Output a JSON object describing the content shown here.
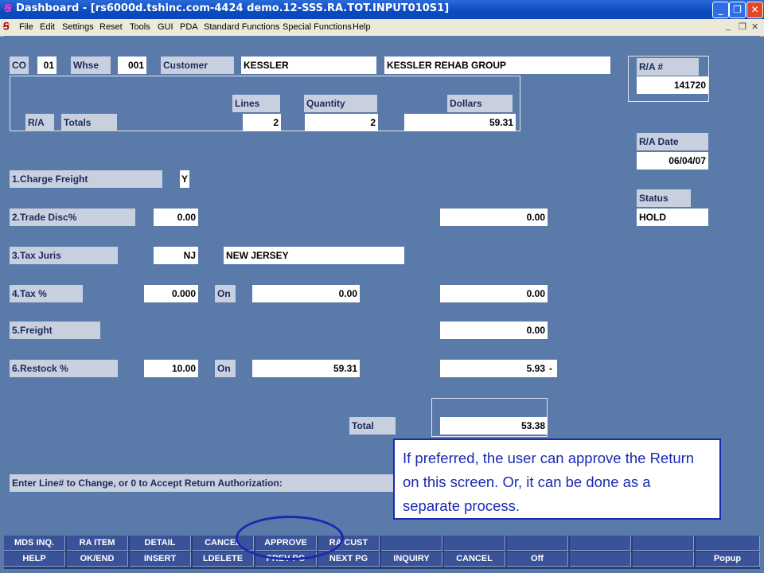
{
  "window": {
    "title": "Dashboard - [rs6000d.tshinc.com-4424 demo.12-SSS.RA.TOT.INPUT010S1]",
    "app_icon": "sss-logo-icon",
    "buttons": {
      "minimize": "_",
      "maximize": "❐",
      "close": "✕"
    }
  },
  "menu": {
    "items": [
      "File",
      "Edit",
      "Settings",
      "Reset",
      "Tools",
      "GUI",
      "PDA",
      "Standard Functions",
      "Special Functions",
      "Help"
    ],
    "mdi_controls": [
      "_",
      "❐",
      "✕"
    ]
  },
  "header": {
    "co_label": "CO",
    "co_value": "01",
    "whse_label": "Whse",
    "whse_value": "001",
    "customer_label": "Customer",
    "customer_value": "KESSLER",
    "customer_name": "KESSLER REHAB GROUP",
    "ra_label": "R/A #",
    "ra_value": "141720"
  },
  "totals_grid": {
    "ra_label": "R/A",
    "totals_label": "Totals",
    "lines_label": "Lines",
    "lines_value": "2",
    "quantity_label": "Quantity",
    "quantity_value": "2",
    "dollars_label": "Dollars",
    "dollars_value": "59.31"
  },
  "side": {
    "ra_date_label": "R/A Date",
    "ra_date_value": "06/04/07",
    "status_label": "Status",
    "status_value": "HOLD"
  },
  "lines": {
    "charge_freight_label": "1.Charge Freight",
    "charge_freight_value": "Y",
    "trade_disc_label": "2.Trade Disc%",
    "trade_disc_value": "0.00",
    "trade_disc_amount": "0.00",
    "tax_juris_label": "3.Tax Juris",
    "tax_juris_code": "NJ",
    "tax_juris_name": "NEW JERSEY",
    "tax_pct_label": "4.Tax %",
    "tax_pct_value": "0.000",
    "tax_on_label": "On",
    "tax_on_value": "0.00",
    "tax_amount": "0.00",
    "freight_label": "5.Freight",
    "freight_amount": "0.00",
    "restock_label": "6.Restock %",
    "restock_value": "10.00",
    "restock_on_label": "On",
    "restock_on_value": "59.31",
    "restock_amount": "5.93",
    "restock_sign": "-"
  },
  "total": {
    "label": "Total",
    "value": "53.38"
  },
  "prompt": {
    "text": "Enter Line# to Change, or 0 to Accept Return Authorization:"
  },
  "callout": {
    "text": "If preferred, the user can approve the Return on this screen.  Or, it can be done as a separate process."
  },
  "fkeys": {
    "row1": [
      "MDS INQ.",
      "RA ITEM",
      "DETAIL",
      "CANCEL",
      "APPROVE",
      "RA CUST",
      "",
      "",
      "",
      "",
      "",
      ""
    ],
    "row2": [
      "HELP",
      "OK/END",
      "INSERT",
      "LDELETE",
      "PREV PG",
      "NEXT PG",
      "INQUIRY",
      "CANCEL",
      "Off",
      "",
      "",
      "Popup"
    ]
  },
  "colors": {
    "background": "#5a7aaa",
    "label": "#c8d0e0",
    "callout_border": "#1a2ab0",
    "fkey": "#3a5298"
  }
}
